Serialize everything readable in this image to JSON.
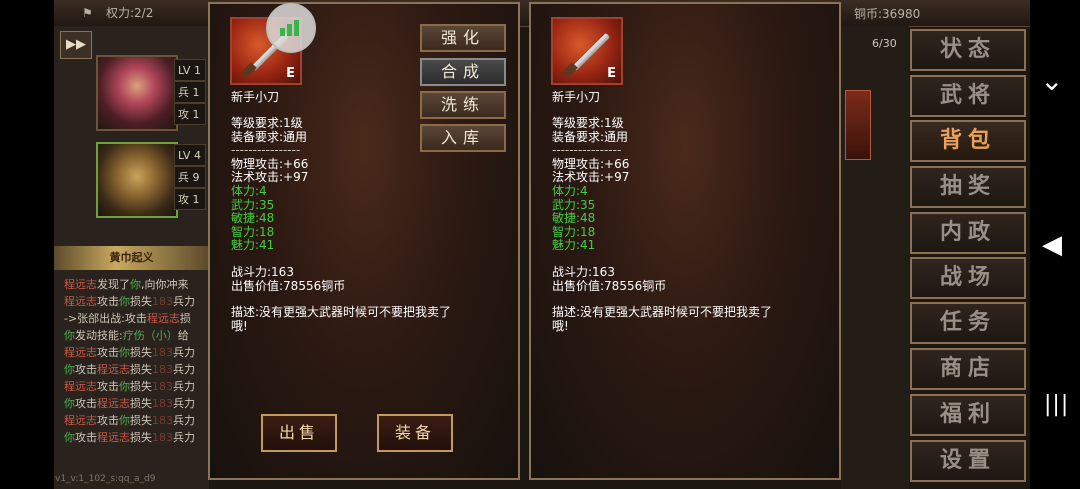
{
  "top": {
    "power": "权力:2/2",
    "coins": "铜币:36980"
  },
  "left": {
    "ff_icon": "fast-forward-icon",
    "heroes": [
      {
        "stats": [
          "LV 1",
          "兵 1",
          "攻 1"
        ]
      },
      {
        "stats": [
          "LV 4",
          "兵 9",
          "攻 1"
        ]
      }
    ],
    "quest_title": "黄巾起义",
    "log": [
      [
        {
          "t": "程远志",
          "c": "red"
        },
        {
          "t": "发现了",
          "c": "w"
        },
        {
          "t": "你",
          "c": "green"
        },
        {
          "t": ",向你冲来",
          "c": "w"
        }
      ],
      [
        {
          "t": "程远志",
          "c": "red"
        },
        {
          "t": "攻击",
          "c": "w"
        },
        {
          "t": "你",
          "c": "green"
        },
        {
          "t": "损失",
          "c": "w"
        },
        {
          "t": "183",
          "c": "dim"
        },
        {
          "t": "兵力",
          "c": "w"
        }
      ],
      [
        {
          "t": "->张郃出战:攻击",
          "c": "w"
        },
        {
          "t": "程远志",
          "c": "red"
        },
        {
          "t": "损",
          "c": "w"
        }
      ],
      [
        {
          "t": "你",
          "c": "green"
        },
        {
          "t": "发动技能:",
          "c": "w"
        },
        {
          "t": "疗伤（小）",
          "c": "green"
        },
        {
          "t": "给",
          "c": "w"
        }
      ],
      [
        {
          "t": "程远志",
          "c": "red"
        },
        {
          "t": "攻击",
          "c": "w"
        },
        {
          "t": "你",
          "c": "green"
        },
        {
          "t": "损失",
          "c": "w"
        },
        {
          "t": "183",
          "c": "dim"
        },
        {
          "t": "兵力",
          "c": "w"
        }
      ],
      [
        {
          "t": "你",
          "c": "green"
        },
        {
          "t": "攻击",
          "c": "w"
        },
        {
          "t": "程远志",
          "c": "red"
        },
        {
          "t": "损失",
          "c": "w"
        },
        {
          "t": "183",
          "c": "dim"
        },
        {
          "t": "兵力",
          "c": "w"
        }
      ],
      [
        {
          "t": "程远志",
          "c": "red"
        },
        {
          "t": "攻击",
          "c": "w"
        },
        {
          "t": "你",
          "c": "green"
        },
        {
          "t": "损失",
          "c": "w"
        },
        {
          "t": "183",
          "c": "dim"
        },
        {
          "t": "兵力",
          "c": "w"
        }
      ],
      [
        {
          "t": "你",
          "c": "green"
        },
        {
          "t": "攻击",
          "c": "w"
        },
        {
          "t": "程远志",
          "c": "red"
        },
        {
          "t": "损失",
          "c": "w"
        },
        {
          "t": "183",
          "c": "dim"
        },
        {
          "t": "兵力",
          "c": "w"
        }
      ],
      [
        {
          "t": "程远志",
          "c": "red"
        },
        {
          "t": "攻击",
          "c": "w"
        },
        {
          "t": "你",
          "c": "green"
        },
        {
          "t": "损失",
          "c": "w"
        },
        {
          "t": "183",
          "c": "dim"
        },
        {
          "t": "兵力",
          "c": "w"
        }
      ],
      [
        {
          "t": "你",
          "c": "green"
        },
        {
          "t": "攻击",
          "c": "w"
        },
        {
          "t": "程远志",
          "c": "red"
        },
        {
          "t": "损失",
          "c": "w"
        },
        {
          "t": "183",
          "c": "dim"
        },
        {
          "t": "兵力",
          "c": "w"
        }
      ]
    ],
    "version": "v1_v:1_102_s:qq_a_d9"
  },
  "item": {
    "name": "新手小刀",
    "grade": "E",
    "level_req": "等级要求:1级",
    "equip_req": "装备要求:通用",
    "divider": "----------------",
    "phys": "物理攻击:+66",
    "magic": "法术攻击:+97",
    "green": [
      "体力:4",
      "武力:35",
      "敏捷:48",
      "智力:18",
      "魅力:41"
    ],
    "power": "战斗力:163",
    "price": "出售价值:78556铜币",
    "desc1": "描述:没有更强大武器时候可不要把我卖了",
    "desc2": "哦!"
  },
  "actions": [
    "强化",
    "合成",
    "洗练",
    "入库"
  ],
  "bottom": {
    "sell": "出售",
    "equip": "装备"
  },
  "right": {
    "count": "6/30",
    "menu": [
      "状态",
      "武将",
      "背包",
      "抽奖",
      "内政",
      "战场",
      "任务",
      "商店",
      "福利",
      "设置"
    ],
    "active_menu": "背包"
  },
  "system": {
    "chevron": "⌄",
    "back": "◀",
    "recents": "|||"
  }
}
